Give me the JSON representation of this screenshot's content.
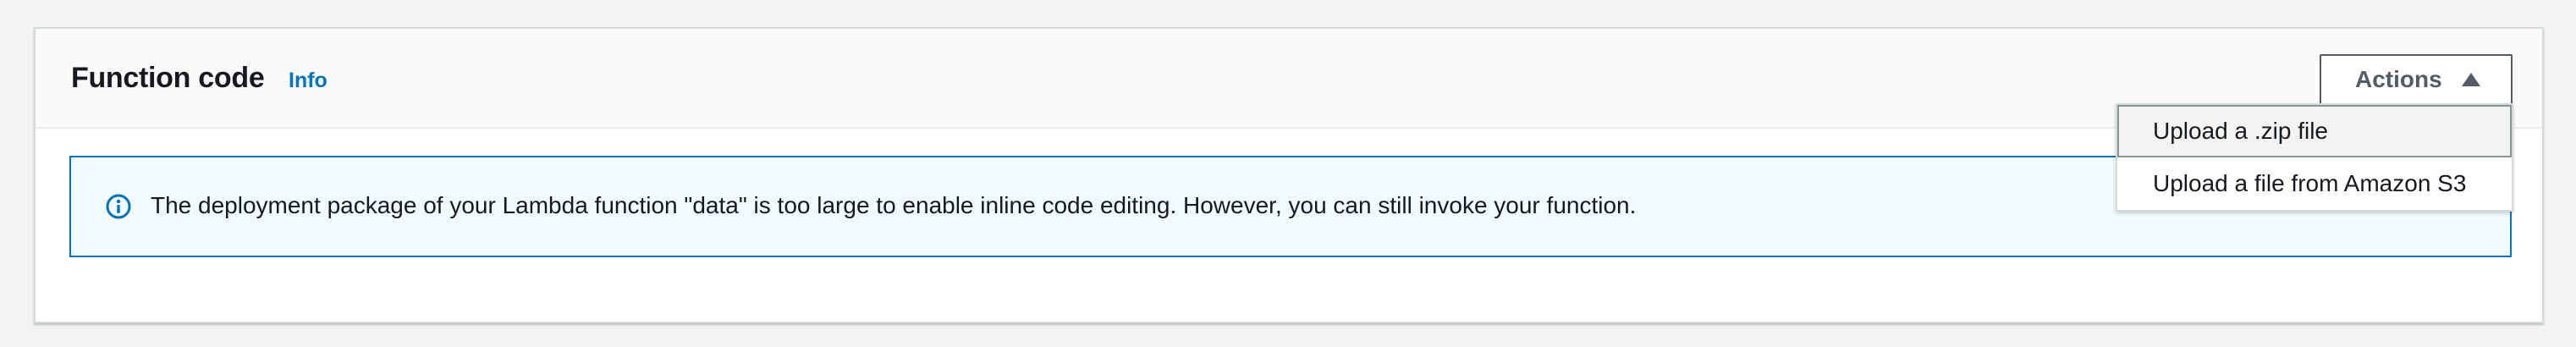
{
  "function_code": {
    "title": "Function code",
    "info_label": "Info",
    "actions_label": "Actions"
  },
  "alert": {
    "icon": "info-circle-icon",
    "message": "The deployment package of your Lambda function \"data\" is too large to enable inline code editing. However, you can still invoke your function."
  },
  "actions_menu": {
    "items": [
      {
        "label": "Upload a .zip file"
      },
      {
        "label": "Upload a file from Amazon S3"
      }
    ]
  },
  "colors": {
    "info_link": "#0073bb",
    "alert_border": "#0073bb",
    "alert_background": "#f1faff",
    "button_text": "#545b64"
  }
}
